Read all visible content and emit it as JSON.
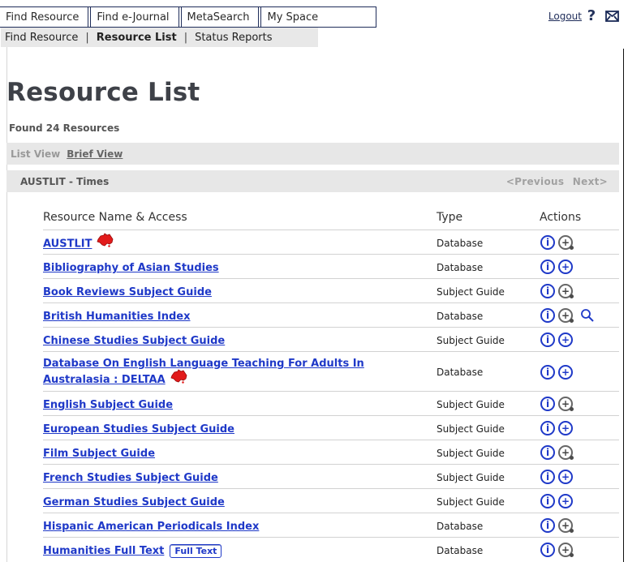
{
  "top_tabs": [
    {
      "label": "Find Resource"
    },
    {
      "label": "Find e-Journal"
    },
    {
      "label": "MetaSearch"
    },
    {
      "label": "My Space"
    }
  ],
  "top_right": {
    "logout": "Logout",
    "help_icon": "question-icon",
    "mail_icon": "mail-icon"
  },
  "subnav": [
    {
      "label": "Find Resource",
      "current": false
    },
    {
      "label": "Resource List",
      "current": true
    },
    {
      "label": "Status Reports",
      "current": false
    }
  ],
  "page_title": "Resource List",
  "found_text": "Found 24 Resources",
  "view_bar": {
    "list_view": "List View",
    "brief_view": "Brief View"
  },
  "result_bar": {
    "range": "AUSTLIT - Times",
    "previous": "<Previous",
    "next": "Next>"
  },
  "table": {
    "headers": {
      "name": "Resource Name & Access",
      "type": "Type",
      "actions": "Actions"
    },
    "rows": [
      {
        "name": "AUSTLIT",
        "type": "Database",
        "aus": true,
        "plus_style": "gray"
      },
      {
        "name": "Bibliography of Asian Studies",
        "type": "Database",
        "aus": false,
        "plus_style": "blue"
      },
      {
        "name": "Book Reviews Subject Guide",
        "type": "Subject Guide",
        "aus": false,
        "plus_style": "gray"
      },
      {
        "name": "British Humanities Index",
        "type": "Database",
        "aus": false,
        "plus_style": "gray",
        "search": true
      },
      {
        "name": "Chinese Studies Subject Guide",
        "type": "Subject Guide",
        "aus": false,
        "plus_style": "blue"
      },
      {
        "name": "Database On English Language Teaching For Adults In Australasia : DELTAA",
        "type": "Database",
        "aus": true,
        "plus_style": "blue",
        "tall": true
      },
      {
        "name": "English Subject Guide",
        "type": "Subject Guide",
        "aus": false,
        "plus_style": "gray"
      },
      {
        "name": "European Studies Subject Guide",
        "type": "Subject Guide",
        "aus": false,
        "plus_style": "blue"
      },
      {
        "name": "Film Subject Guide",
        "type": "Subject Guide",
        "aus": false,
        "plus_style": "gray"
      },
      {
        "name": "French Studies Subject Guide",
        "type": "Subject Guide",
        "aus": false,
        "plus_style": "blue"
      },
      {
        "name": "German Studies Subject Guide",
        "type": "Subject Guide",
        "aus": false,
        "plus_style": "blue"
      },
      {
        "name": "Hispanic American Periodicals Index",
        "type": "Database",
        "aus": false,
        "plus_style": "gray"
      },
      {
        "name": "Humanities Full Text",
        "type": "Database",
        "aus": false,
        "plus_style": "gray",
        "badge": "Full Text"
      }
    ]
  },
  "colors": {
    "link": "#1f39c8",
    "bar": "#e7e7e7",
    "muted": "#a1a1a1",
    "australia_red": "#e21b1b"
  },
  "icons": {
    "info": "info-icon",
    "add": "add-icon",
    "search": "search-icon",
    "australia": "australia-map-icon"
  }
}
